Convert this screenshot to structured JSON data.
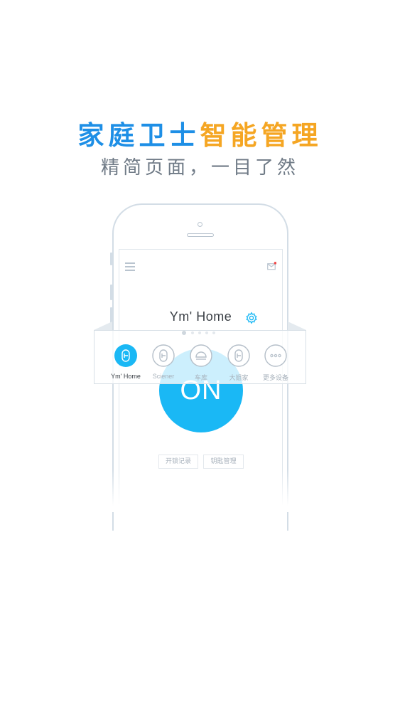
{
  "headline": {
    "part1": "家庭卫士",
    "part2": "智能管理",
    "color_part1": "#1e8fe6",
    "color_part2": "#f5a623"
  },
  "subline": "精简页面，一目了然",
  "app": {
    "home_title": "Ym' Home",
    "power_label": "ON",
    "power_color": "#1ab8f5",
    "buttons": {
      "unlock_log": "开锁记录",
      "key_manage": "钥匙管理"
    },
    "devices": [
      {
        "label": "Ym' Home",
        "icon": "lock-icon",
        "active": true
      },
      {
        "label": "Sciener",
        "icon": "lock-icon",
        "active": false
      },
      {
        "label": "车库",
        "icon": "garage-icon",
        "active": false
      },
      {
        "label": "大姐家",
        "icon": "lock-icon",
        "active": false
      },
      {
        "label": "更多设备",
        "icon": "more-icon",
        "active": false
      }
    ],
    "icons": {
      "menu": "menu-icon",
      "mail": "mail-icon",
      "settings": "gear-icon"
    }
  }
}
